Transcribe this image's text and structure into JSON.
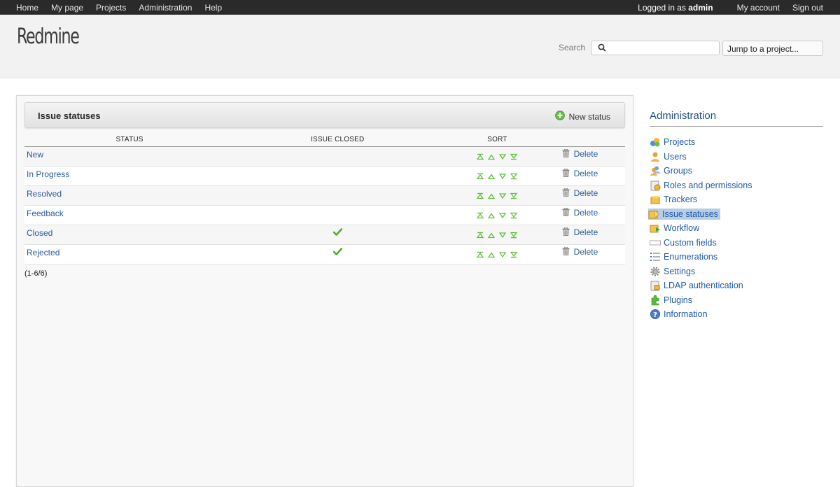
{
  "top_menu": {
    "left": [
      "Home",
      "My page",
      "Projects",
      "Administration",
      "Help"
    ],
    "logged_in_prefix": "Logged in as",
    "logged_in_user": "admin",
    "my_account": "My account",
    "sign_out": "Sign out"
  },
  "header": {
    "logo": "Redmine",
    "search_label": "Search",
    "search_value": "",
    "jump_to_project": "Jump to a project..."
  },
  "main": {
    "title": "Issue statuses",
    "new_status": "New status",
    "columns": [
      "Status",
      "Issue closed",
      "Sort"
    ],
    "rows": [
      {
        "name": "New",
        "closed": false,
        "delete": "Delete"
      },
      {
        "name": "In Progress",
        "closed": false,
        "delete": "Delete"
      },
      {
        "name": "Resolved",
        "closed": false,
        "delete": "Delete"
      },
      {
        "name": "Feedback",
        "closed": false,
        "delete": "Delete"
      },
      {
        "name": "Closed",
        "closed": true,
        "delete": "Delete"
      },
      {
        "name": "Rejected",
        "closed": true,
        "delete": "Delete"
      }
    ],
    "pagination": "(1-6/6)"
  },
  "sidebar": {
    "title": "Administration",
    "items": [
      {
        "label": "Projects",
        "icon": "projects-icon"
      },
      {
        "label": "Users",
        "icon": "user-icon"
      },
      {
        "label": "Groups",
        "icon": "group-icon"
      },
      {
        "label": "Roles and permissions",
        "icon": "roles-icon"
      },
      {
        "label": "Trackers",
        "icon": "tracker-icon"
      },
      {
        "label": "Issue statuses",
        "icon": "issue-status-icon",
        "selected": true
      },
      {
        "label": "Workflow",
        "icon": "workflow-icon"
      },
      {
        "label": "Custom fields",
        "icon": "custom-fields-icon"
      },
      {
        "label": "Enumerations",
        "icon": "list-icon"
      },
      {
        "label": "Settings",
        "icon": "gear-icon"
      },
      {
        "label": "LDAP authentication",
        "icon": "ldap-icon"
      },
      {
        "label": "Plugins",
        "icon": "plugin-icon"
      },
      {
        "label": "Information",
        "icon": "info-icon"
      }
    ]
  },
  "colors": {
    "link": "#2a5a9a",
    "sidebar_selected": "#b7cde6",
    "top_bar": "#2a2a2a",
    "check_green": "#4caf1f"
  }
}
